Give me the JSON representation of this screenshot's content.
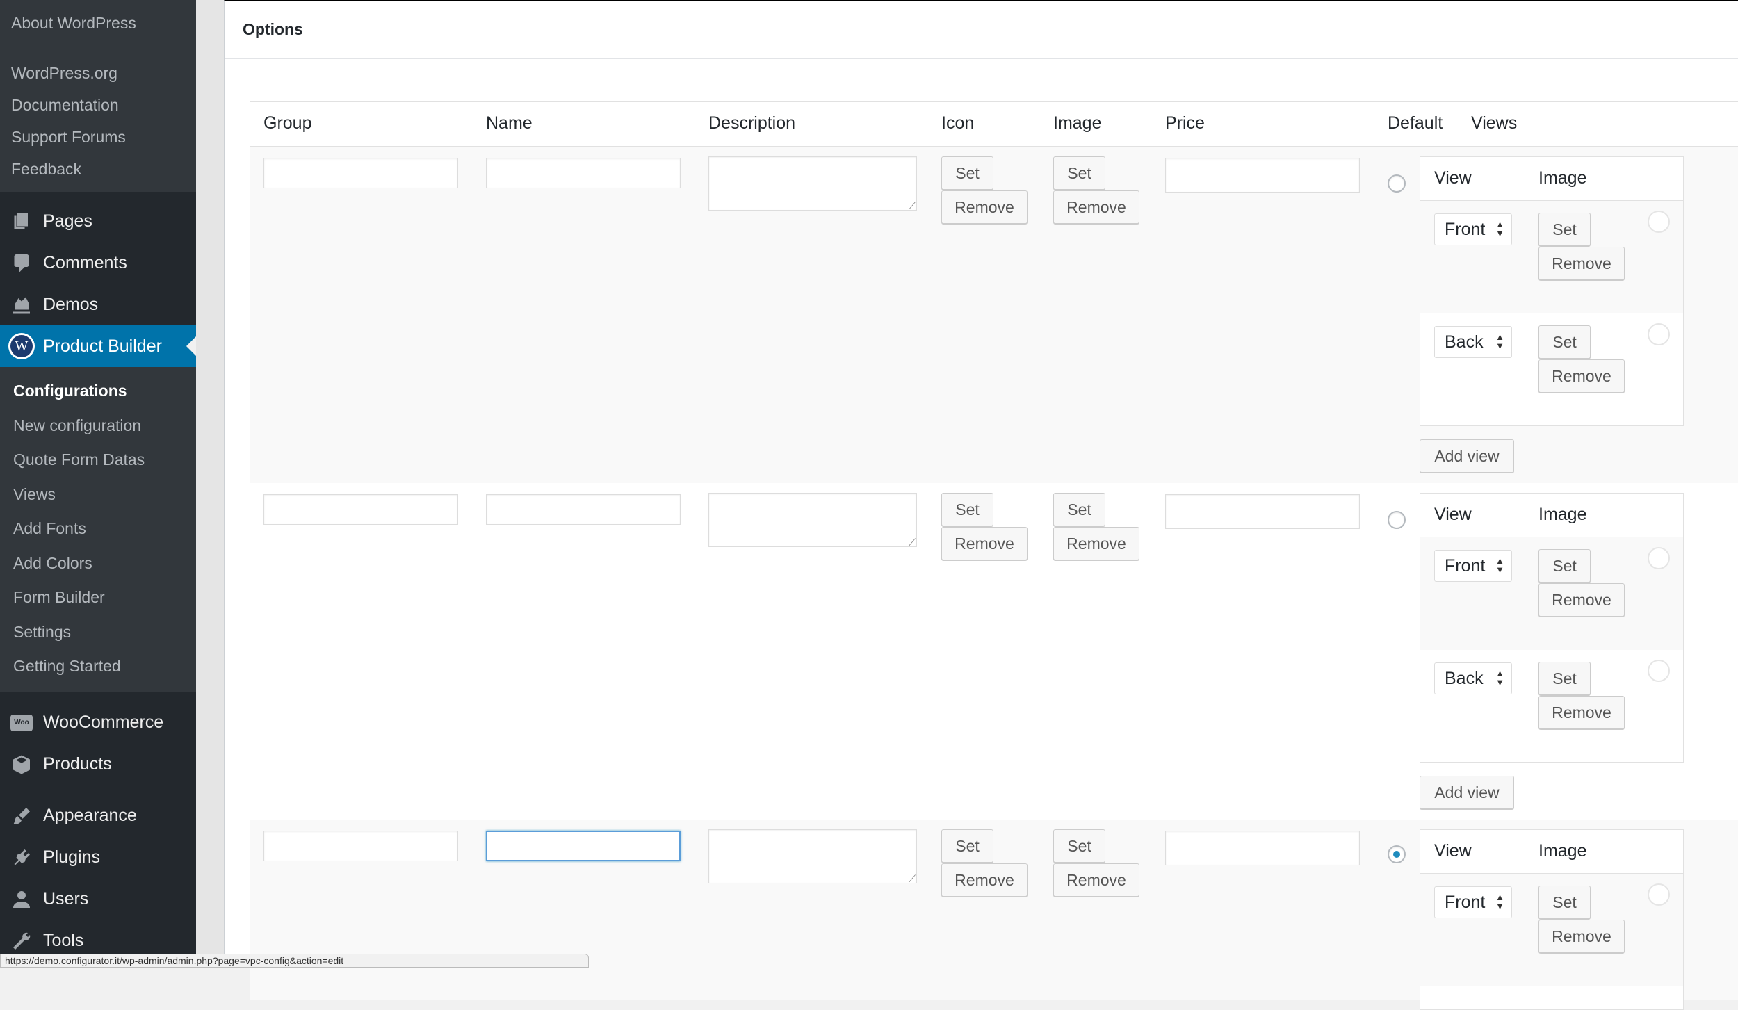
{
  "sidebar": {
    "about": "About WordPress",
    "wp_links": [
      "WordPress.org",
      "Documentation",
      "Support Forums",
      "Feedback"
    ],
    "menu_top": [
      {
        "label": "Pages",
        "icon": "pages-icon"
      },
      {
        "label": "Comments",
        "icon": "comments-icon"
      },
      {
        "label": "Demos",
        "icon": "demos-icon"
      }
    ],
    "current": {
      "label": "Product Builder",
      "icon": "product-builder-logo-icon"
    },
    "submenu": [
      "Configurations",
      "New configuration",
      "Quote Form Datas",
      "Views",
      "Add Fonts",
      "Add Colors",
      "Form Builder",
      "Settings",
      "Getting Started"
    ],
    "menu_bottom_a": [
      {
        "label": "WooCommerce",
        "icon": "woocommerce-icon",
        "badge": "Woo"
      },
      {
        "label": "Products",
        "icon": "products-icon"
      }
    ],
    "menu_bottom_b": [
      {
        "label": "Appearance",
        "icon": "appearance-icon"
      },
      {
        "label": "Plugins",
        "icon": "plugins-icon"
      },
      {
        "label": "Users",
        "icon": "users-icon"
      },
      {
        "label": "Tools",
        "icon": "tools-icon"
      }
    ]
  },
  "panel": {
    "title": "Options",
    "columns": [
      "Group",
      "Name",
      "Description",
      "Icon",
      "Image",
      "Price",
      "Default",
      "Views"
    ],
    "buttons": {
      "set": "Set",
      "remove": "Remove",
      "add_view": "Add view"
    },
    "views_table": {
      "col_view": "View",
      "col_image": "Image"
    },
    "rows": [
      {
        "default_checked": false,
        "views": [
          "Front",
          "Back"
        ],
        "name_focused": false
      },
      {
        "default_checked": false,
        "views": [
          "Front",
          "Back"
        ],
        "name_focused": false
      },
      {
        "default_checked": true,
        "views": [
          "Front"
        ],
        "name_focused": true
      }
    ]
  },
  "status_bar": "https://demo.configurator.it/wp-admin/admin.php?page=vpc-config&action=edit"
}
